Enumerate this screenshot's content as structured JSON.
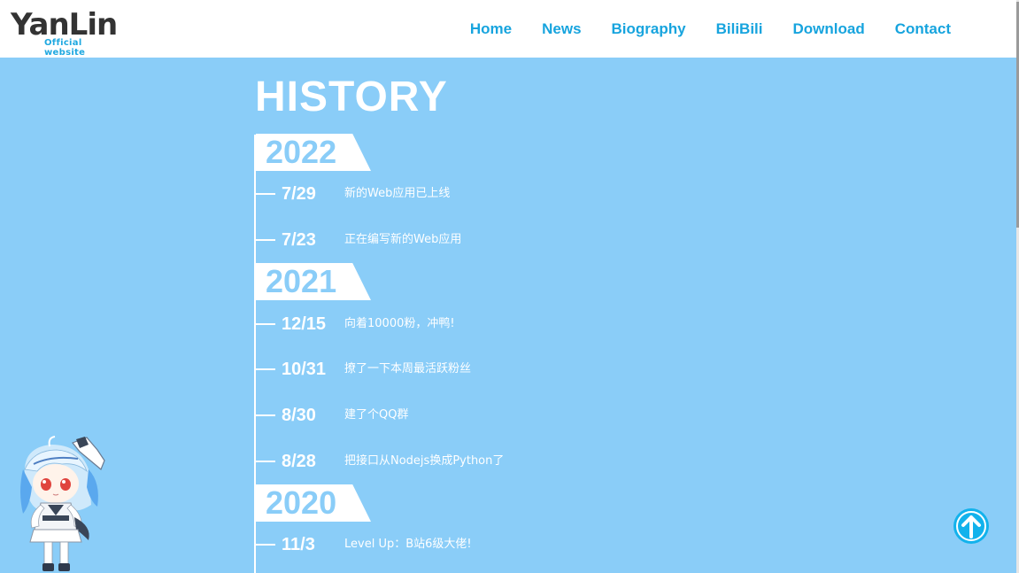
{
  "header": {
    "logo": {
      "main": "YanLin",
      "sub": "Official website"
    },
    "nav": [
      "Home",
      "News",
      "Biography",
      "BiliBili",
      "Download",
      "Contact"
    ]
  },
  "history": {
    "title": "HISTORY",
    "years": [
      {
        "year": "2022",
        "entries": [
          {
            "date": "7/29",
            "text": "新的Web应用已上线"
          },
          {
            "date": "7/23",
            "text": "正在编写新的Web应用"
          }
        ]
      },
      {
        "year": "2021",
        "entries": [
          {
            "date": "12/15",
            "text": "向着10000粉，冲鸭!"
          },
          {
            "date": "10/31",
            "text": "撩了一下本周最活跃粉丝"
          },
          {
            "date": "8/30",
            "text": "建了个QQ群"
          },
          {
            "date": "8/28",
            "text": "把接口从Nodejs换成Python了"
          }
        ]
      },
      {
        "year": "2020",
        "entries": [
          {
            "date": "11/3",
            "text": "Level Up：B站6级大佬!"
          }
        ]
      }
    ]
  },
  "icons": {
    "back_to_top": "arrow-up-icon",
    "mascot": "anime-mascot"
  },
  "colors": {
    "background": "#8acdf8",
    "nav": "#17a4de",
    "accent": "#12b2ec",
    "header_bg": "#ffffff"
  }
}
